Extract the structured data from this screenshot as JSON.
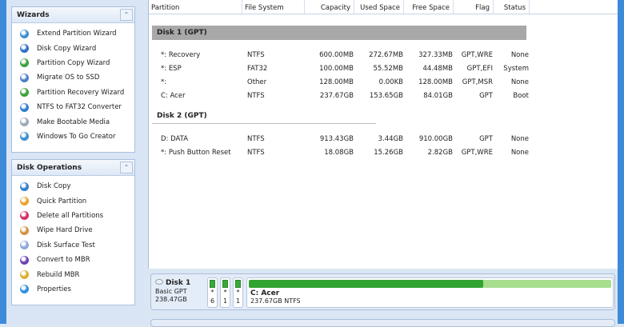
{
  "wizards": {
    "title": "Wizards",
    "items": [
      "Extend Partition Wizard",
      "Disk Copy Wizard",
      "Partition Copy Wizard",
      "Migrate OS to SSD",
      "Partition Recovery Wizard",
      "NTFS to FAT32 Converter",
      "Make Bootable Media",
      "Windows To Go Creator"
    ],
    "colors": [
      "#3a8fd0",
      "#2f6fc4",
      "#3aa03a",
      "#4a7fc8",
      "#3aa03a",
      "#2f7fd0",
      "#9aa8b8",
      "#3a8fd0"
    ]
  },
  "disk_ops": {
    "title": "Disk Operations",
    "items": [
      "Disk Copy",
      "Quick Partition",
      "Delete all Partitions",
      "Wipe Hard Drive",
      "Disk Surface Test",
      "Convert to MBR",
      "Rebuild MBR",
      "Properties"
    ],
    "colors": [
      "#2f7fd0",
      "#e8a030",
      "#d03060",
      "#d09040",
      "#8aa8d8",
      "#6a40b0",
      "#d8b030",
      "#2f8fe0"
    ]
  },
  "table": {
    "headers": [
      "Partition",
      "File System",
      "Capacity",
      "Used Space",
      "Free Space",
      "Flag",
      "Status"
    ],
    "disks": [
      {
        "name": "Disk 1 (GPT)",
        "rows": [
          [
            "*: Recovery",
            "NTFS",
            "600.00MB",
            "272.67MB",
            "327.33MB",
            "GPT,WRE",
            "None"
          ],
          [
            "*: ESP",
            "FAT32",
            "100.00MB",
            "55.52MB",
            "44.48MB",
            "GPT,EFI",
            "System"
          ],
          [
            "*:",
            "Other",
            "128.00MB",
            "0.00KB",
            "128.00MB",
            "GPT,MSR",
            "None"
          ],
          [
            "C: Acer",
            "NTFS",
            "237.67GB",
            "153.65GB",
            "84.01GB",
            "GPT",
            "Boot"
          ]
        ]
      },
      {
        "name": "Disk 2 (GPT)",
        "rows": [
          [
            "D: DATA",
            "NTFS",
            "913.43GB",
            "3.44GB",
            "910.00GB",
            "GPT",
            "None"
          ],
          [
            "*: Push Button Reset",
            "NTFS",
            "18.08GB",
            "15.26GB",
            "2.82GB",
            "GPT,WRE",
            "None"
          ]
        ]
      }
    ]
  },
  "diskmap": {
    "name": "Disk 1",
    "type": "Basic GPT",
    "size": "238.47GB",
    "mini": [
      {
        "star": "*",
        "num": "6"
      },
      {
        "star": "*",
        "num": "1"
      },
      {
        "star": "*",
        "num": "1"
      }
    ],
    "main_label": "C: Acer",
    "main_info": "237.67GB NTFS",
    "used_fraction": 0.646
  }
}
